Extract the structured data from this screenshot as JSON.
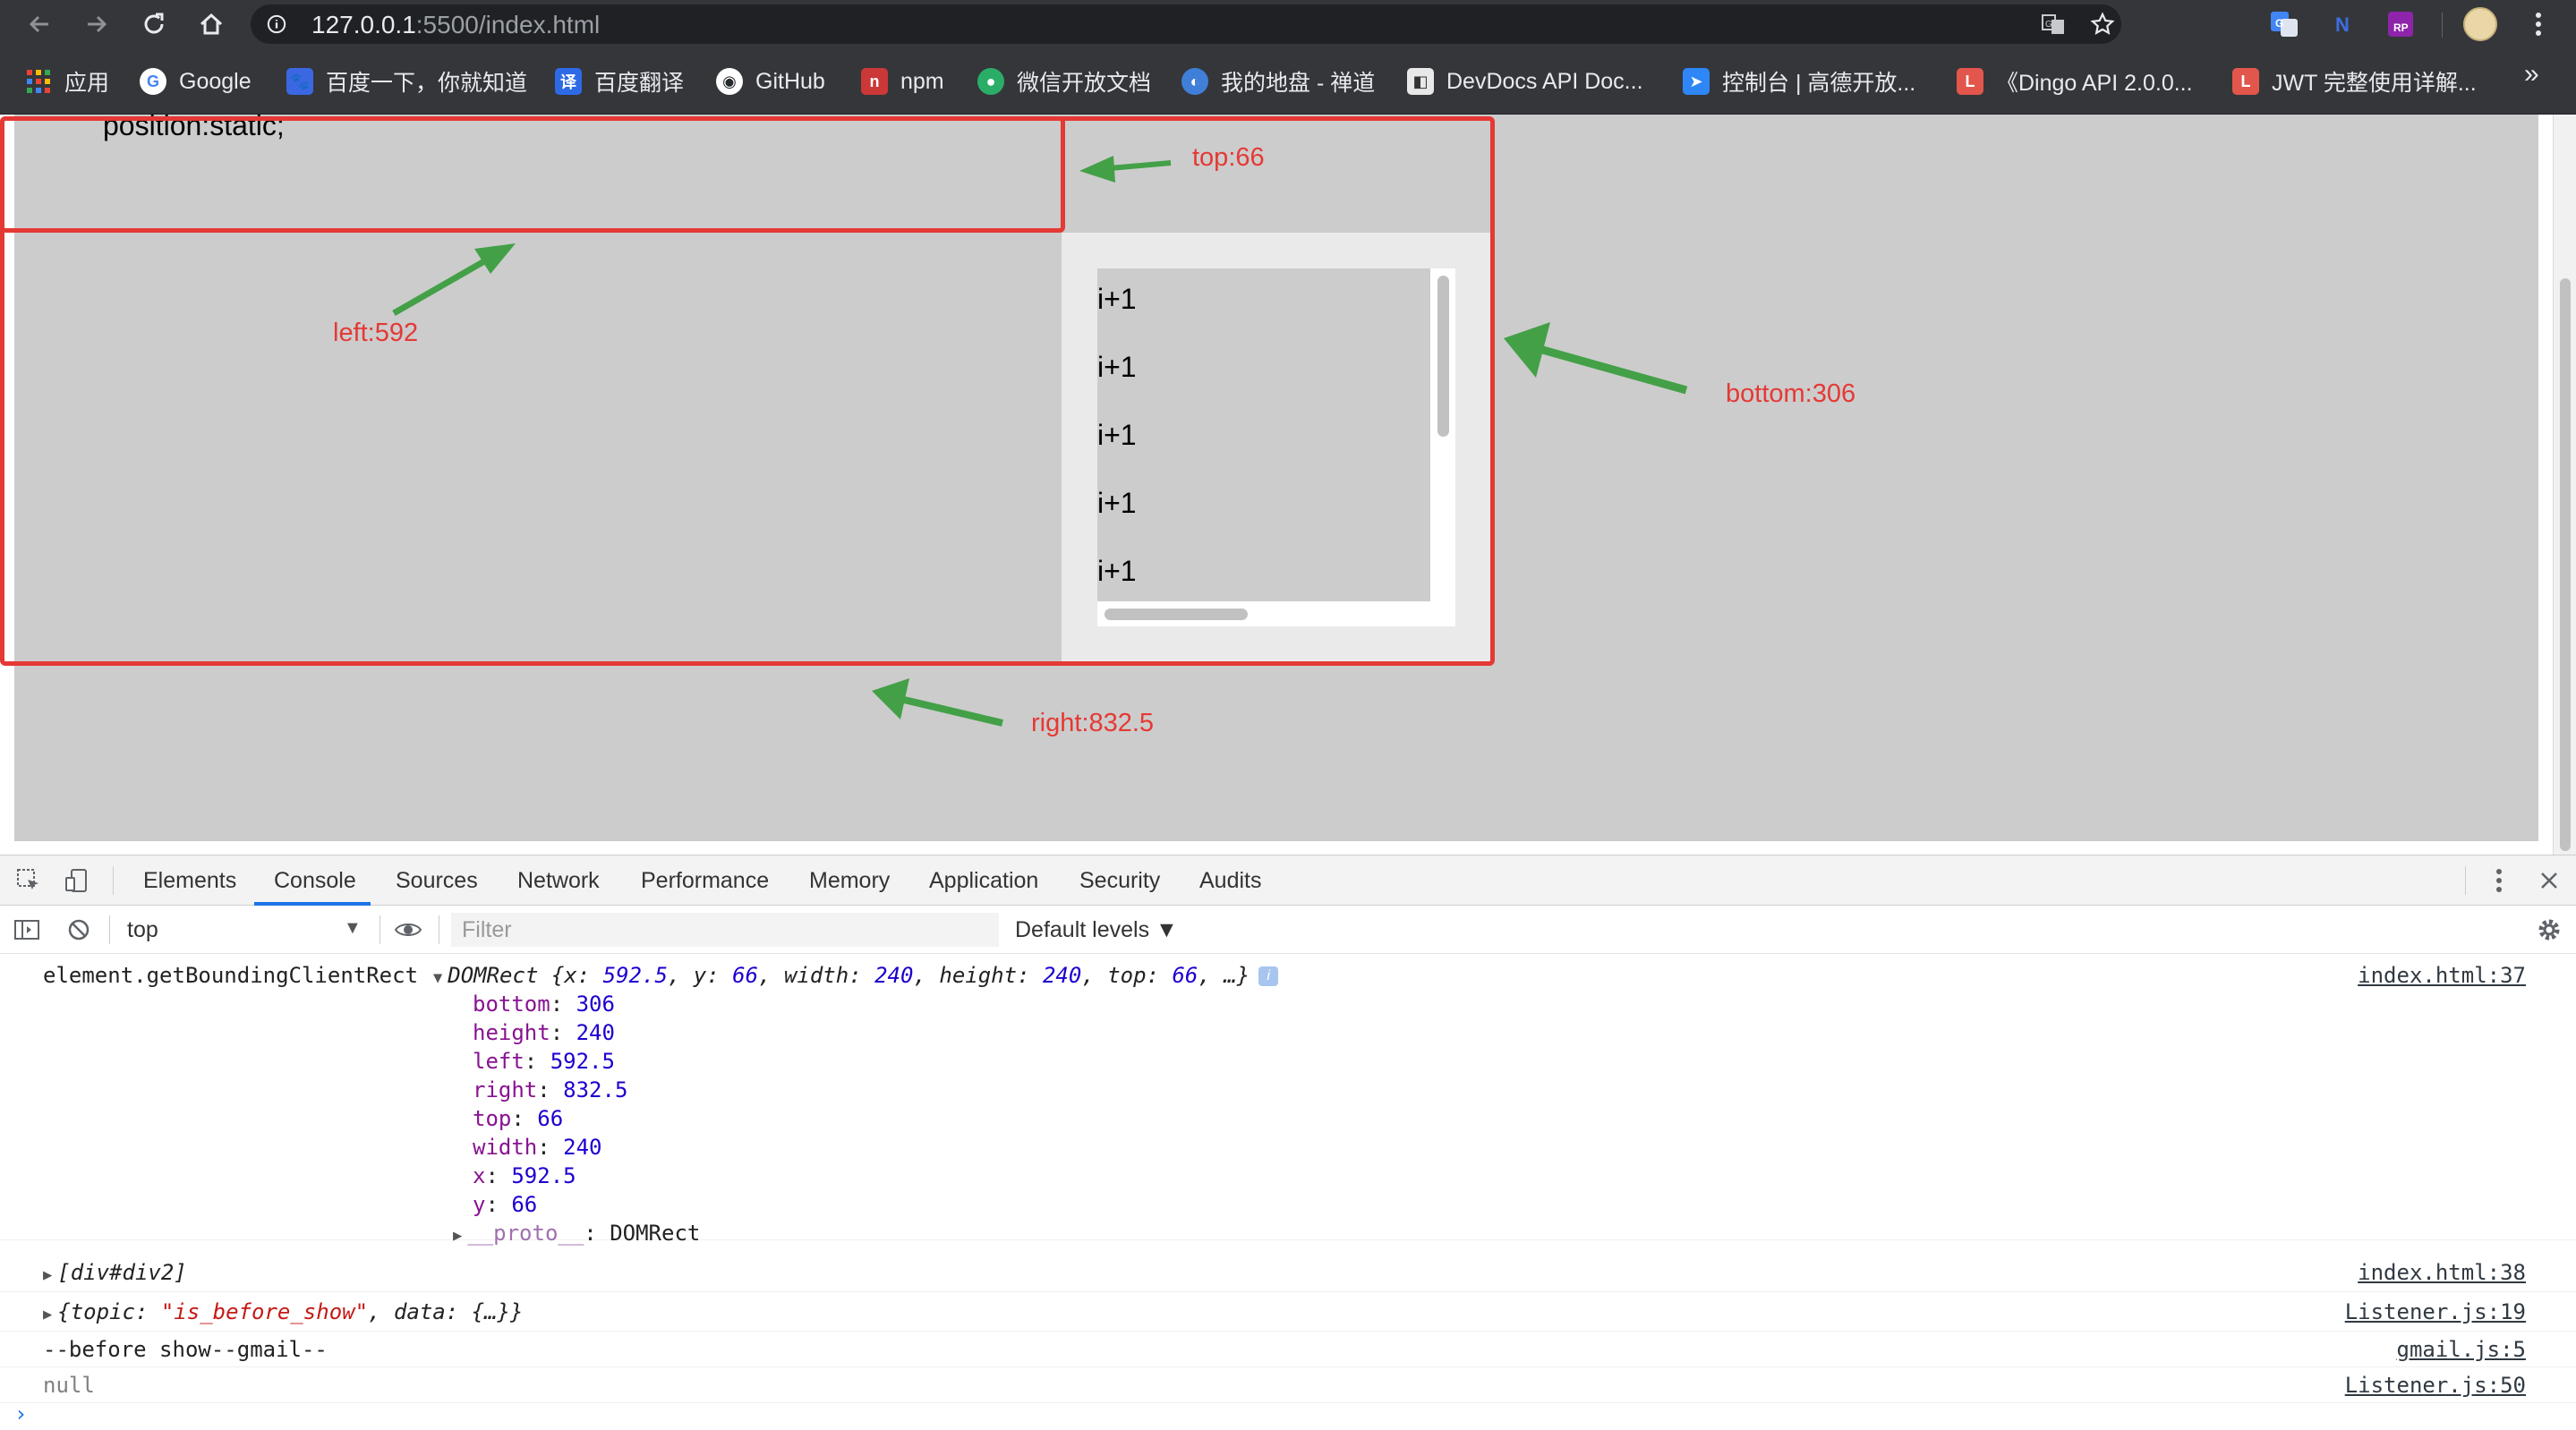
{
  "browser": {
    "url_host": "127.0.0.1",
    "url_rest": ":5500/index.html",
    "bookmarks": [
      {
        "label": "应用",
        "icon": "apps-grid-icon",
        "color": "#e34a3e"
      },
      {
        "label": "Google",
        "icon": "google-icon",
        "color": "#ffffff"
      },
      {
        "label": "百度一下，你就知道",
        "icon": "baidu-icon",
        "color": "#3b67e3"
      },
      {
        "label": "百度翻译",
        "icon": "baidu-translate-icon",
        "color": "#2e6ae6"
      },
      {
        "label": "GitHub",
        "icon": "github-icon",
        "color": "#24292e"
      },
      {
        "label": "npm",
        "icon": "npm-icon",
        "color": "#cb3837"
      },
      {
        "label": "微信开放文档",
        "icon": "wechat-icon",
        "color": "#2aae67"
      },
      {
        "label": "我的地盘 - 禅道",
        "icon": "zentao-icon",
        "color": "#3f7fd8"
      },
      {
        "label": "DevDocs API Doc...",
        "icon": "devdocs-icon",
        "color": "#e8e8e8"
      },
      {
        "label": "控制台 | 高德开放...",
        "icon": "amap-icon",
        "color": "#2f86f6"
      },
      {
        "label": "《Dingo API 2.0.0...",
        "icon": "laravel-icon",
        "color": "#e2564b"
      },
      {
        "label": "JWT 完整使用详解...",
        "icon": "laravel-icon",
        "color": "#e2564b"
      }
    ],
    "bookmarks_more": "»"
  },
  "page": {
    "static_label": "position:static;",
    "list_items": [
      "i+1",
      "i+1",
      "i+1",
      "i+1",
      "i+1"
    ],
    "annotations": {
      "top": "top:66",
      "left": "left:592",
      "bottom": "bottom:306",
      "right": "right:832.5"
    },
    "annotation_color": "#e53935",
    "arrow_color": "#43a047"
  },
  "devtools": {
    "tabs": [
      "Elements",
      "Console",
      "Sources",
      "Network",
      "Performance",
      "Memory",
      "Application",
      "Security",
      "Audits"
    ],
    "active_tab": "Console",
    "context": "top",
    "filter_placeholder": "Filter",
    "levels": "Default levels ▼",
    "console": {
      "rect_label": "element.getBoundingClientRect",
      "rect_source": "index.html:37",
      "rect_summary": {
        "type": "DOMRect",
        "x": "592.5",
        "y": "66",
        "width": "240",
        "height": "240",
        "top": "66"
      },
      "rect_props": [
        {
          "name": "bottom",
          "value": "306"
        },
        {
          "name": "height",
          "value": "240"
        },
        {
          "name": "left",
          "value": "592.5"
        },
        {
          "name": "right",
          "value": "832.5"
        },
        {
          "name": "top",
          "value": "66"
        },
        {
          "name": "width",
          "value": "240"
        },
        {
          "name": "x",
          "value": "592.5"
        },
        {
          "name": "y",
          "value": "66"
        }
      ],
      "proto_name": "__proto__",
      "proto_value": "DOMRect",
      "div_array": "[div#div2]",
      "div_source": "index.html:38",
      "topic_key": "topic",
      "topic_value": "\"is_before_show\"",
      "data_key": "data",
      "data_value": "{…}",
      "topic_source": "Listener.js:19",
      "log_text": "--before show--gmail--",
      "log_source": "gmail.js:5",
      "null_text": "null",
      "null_source": "Listener.js:50"
    }
  }
}
